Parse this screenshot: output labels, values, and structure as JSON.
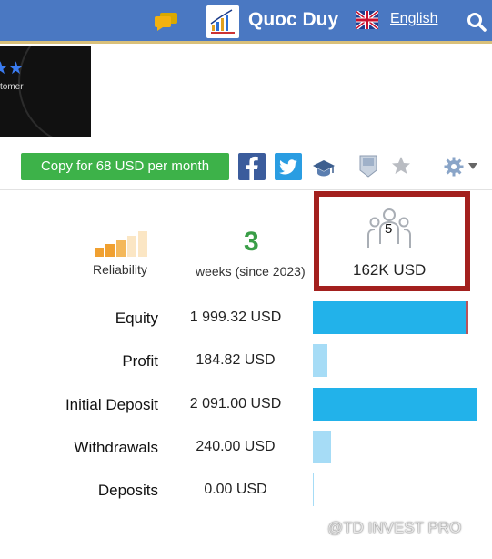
{
  "header": {
    "username": "Quoc Duy",
    "language": "English",
    "colors": {
      "bar": "#4a78c2",
      "accent": "#f3b10f"
    },
    "icons": [
      "chat-icon",
      "avatar-chart-icon",
      "uk-flag-icon",
      "search-icon"
    ]
  },
  "banner": {
    "text": "tomer"
  },
  "actions": {
    "copy_label": "Copy for 68 USD per month",
    "copy_color": "#3db249",
    "icons": [
      "facebook-icon",
      "twitter-icon",
      "graduation-cap-icon",
      "badge-icon",
      "star-icon",
      "gear-icon",
      "caret-down-icon"
    ]
  },
  "stats": {
    "reliability_label": "Reliability",
    "reliability_level": 2,
    "reliability_max": 5,
    "weeks_value": "3",
    "weeks_label": "weeks (since 2023)",
    "subscribers_count": "5",
    "subscribers_funds": "162K USD"
  },
  "rows": [
    {
      "label": "Equity",
      "value": "1 999.32 USD",
      "fraction": 0.95,
      "color": "#22b2ea"
    },
    {
      "label": "Profit",
      "value": "184.82 USD",
      "fraction": 0.09,
      "color": "#a6dcf6"
    },
    {
      "label": "Initial Deposit",
      "value": "2 091.00 USD",
      "fraction": 1.0,
      "color": "#22b2ea"
    },
    {
      "label": "Withdrawals",
      "value": "240.00 USD",
      "fraction": 0.11,
      "color": "#a6dcf6"
    },
    {
      "label": "Deposits",
      "value": "0.00 USD",
      "fraction": 0.0,
      "color": "#a6dcf6"
    }
  ],
  "watermark": "@TD INVEST PRO"
}
